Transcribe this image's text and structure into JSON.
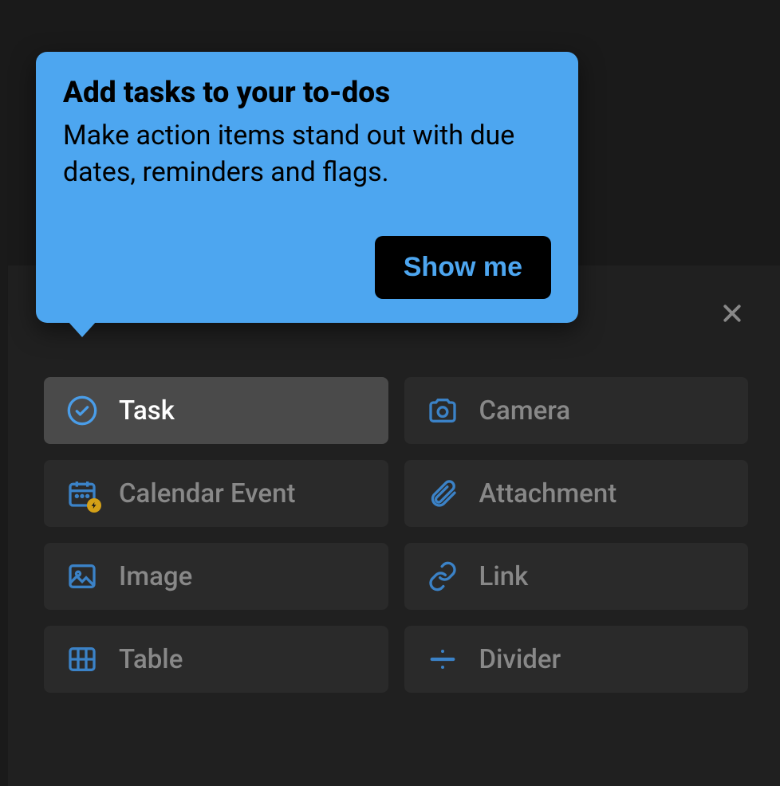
{
  "tooltip": {
    "title": "Add tasks to your to-dos",
    "body": "Make action items stand out with due dates, reminders and flags.",
    "cta": "Show me"
  },
  "options": {
    "task": "Task",
    "camera": "Camera",
    "calendar": "Calendar Event",
    "attachment": "Attachment",
    "image": "Image",
    "link": "Link",
    "table": "Table",
    "divider": "Divider"
  }
}
